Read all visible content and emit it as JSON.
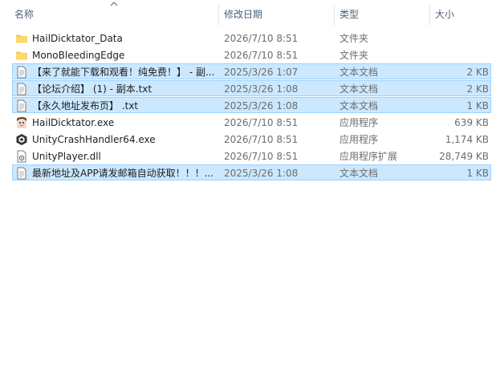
{
  "columns": {
    "name": "名称",
    "date": "修改日期",
    "type": "类型",
    "size": "大小"
  },
  "files": [
    {
      "name": "HailDicktator_Data",
      "date": "2026/7/10 8:51",
      "type": "文件夹",
      "size": "",
      "icon": "folder-icon",
      "selected": false
    },
    {
      "name": "MonoBleedingEdge",
      "date": "2026/7/10 8:51",
      "type": "文件夹",
      "size": "",
      "icon": "folder-icon",
      "selected": false
    },
    {
      "name": "【来了就能下载和观看！纯免费！】 - 副...",
      "date": "2025/3/26 1:07",
      "type": "文本文档",
      "size": "2 KB",
      "icon": "text-file-icon",
      "selected": true
    },
    {
      "name": "【论坛介绍】 (1) - 副本.txt",
      "date": "2025/3/26 1:08",
      "type": "文本文档",
      "size": "2 KB",
      "icon": "text-file-icon",
      "selected": true
    },
    {
      "name": "【永久地址发布页】 .txt",
      "date": "2025/3/26 1:08",
      "type": "文本文档",
      "size": "1 KB",
      "icon": "text-file-icon",
      "selected": true
    },
    {
      "name": "HailDicktator.exe",
      "date": "2026/7/10 8:51",
      "type": "应用程序",
      "size": "639 KB",
      "icon": "app-character-icon",
      "selected": false
    },
    {
      "name": "UnityCrashHandler64.exe",
      "date": "2026/7/10 8:51",
      "type": "应用程序",
      "size": "1,174 KB",
      "icon": "unity-icon",
      "selected": false
    },
    {
      "name": "UnityPlayer.dll",
      "date": "2026/7/10 8:51",
      "type": "应用程序扩展",
      "size": "28,749 KB",
      "icon": "dll-file-icon",
      "selected": false
    },
    {
      "name": "最新地址及APP请发邮箱自动获取！！！...",
      "date": "2025/3/26 1:08",
      "type": "文本文档",
      "size": "1 KB",
      "icon": "text-file-icon",
      "selected": true
    }
  ]
}
